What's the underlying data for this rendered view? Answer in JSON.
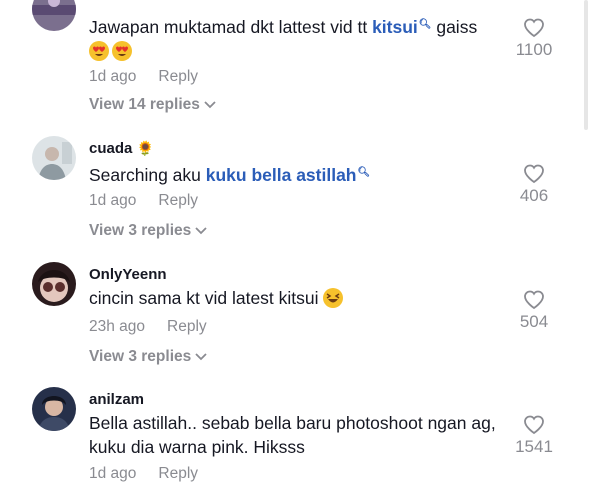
{
  "comments": [
    {
      "text_before": "Jawapan muktamad dkt lattest vid tt ",
      "link": "kitsui",
      "text_after": " gaiss",
      "emoji_icons": [
        "heart-eyes-emoji-icon",
        "heart-eyes-emoji-icon"
      ],
      "time": "1d ago",
      "reply_label": "Reply",
      "view_replies": "View 14 replies",
      "likes": "1100"
    },
    {
      "username": "cuada",
      "badge_icon": "sunflower-icon",
      "text_before": "Searching aku ",
      "link": "kuku bella astillah",
      "time": "1d ago",
      "reply_label": "Reply",
      "view_replies": "View 3 replies",
      "likes": "406"
    },
    {
      "username": "OnlyYeenn",
      "text": "cincin sama kt vid latest kitsui",
      "emoji_icon": "laughing-emoji-icon",
      "time": "23h ago",
      "reply_label": "Reply",
      "view_replies": "View 3 replies",
      "likes": "504"
    },
    {
      "username": "anilzam",
      "text": "Bella astillah.. sebab bella baru photoshoot ngan ag, kuku dia warna pink. Hiksss",
      "time": "1d ago",
      "reply_label": "Reply",
      "likes": "1541"
    }
  ],
  "colors": {
    "link": "#2b5db8",
    "meta": "#8a8b91",
    "text": "#161823"
  }
}
